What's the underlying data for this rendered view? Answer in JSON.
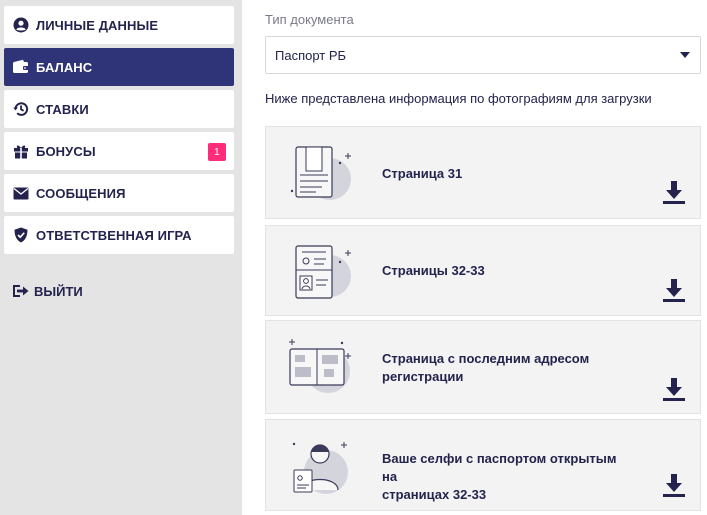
{
  "sidebar": {
    "items": [
      {
        "label": "Личные данные",
        "icon": "user-icon",
        "active": false
      },
      {
        "label": "Баланс",
        "icon": "wallet-icon",
        "active": true
      },
      {
        "label": "Ставки",
        "icon": "history-icon",
        "active": false
      },
      {
        "label": "Бонусы",
        "icon": "gift-icon",
        "active": false,
        "badge": "1"
      },
      {
        "label": "Сообщения",
        "icon": "envelope-icon",
        "active": false
      },
      {
        "label": "Ответственная игра",
        "icon": "shield-icon",
        "active": false
      }
    ],
    "logout_label": "Выйти"
  },
  "main": {
    "doc_type_label": "Тип документа",
    "doc_type_value": "Паспорт РБ",
    "info_text": "Ниже представлена информация по фотографиям для загрузки",
    "cards": [
      {
        "title_line1": "Страница 31",
        "title_line2": ""
      },
      {
        "title_line1": "Страницы 32-33",
        "title_line2": ""
      },
      {
        "title_line1": "Страница с последним адресом",
        "title_line2": "регистрации"
      },
      {
        "title_line1": "Ваше селфи с паспортом открытым на",
        "title_line2": "страницах 32-33"
      }
    ]
  },
  "colors": {
    "accent": "#2f3378",
    "text": "#23234d",
    "badge": "#ff2c7a",
    "sidebar_bg": "#e4e4e4",
    "card_bg": "#f3f3f3"
  }
}
